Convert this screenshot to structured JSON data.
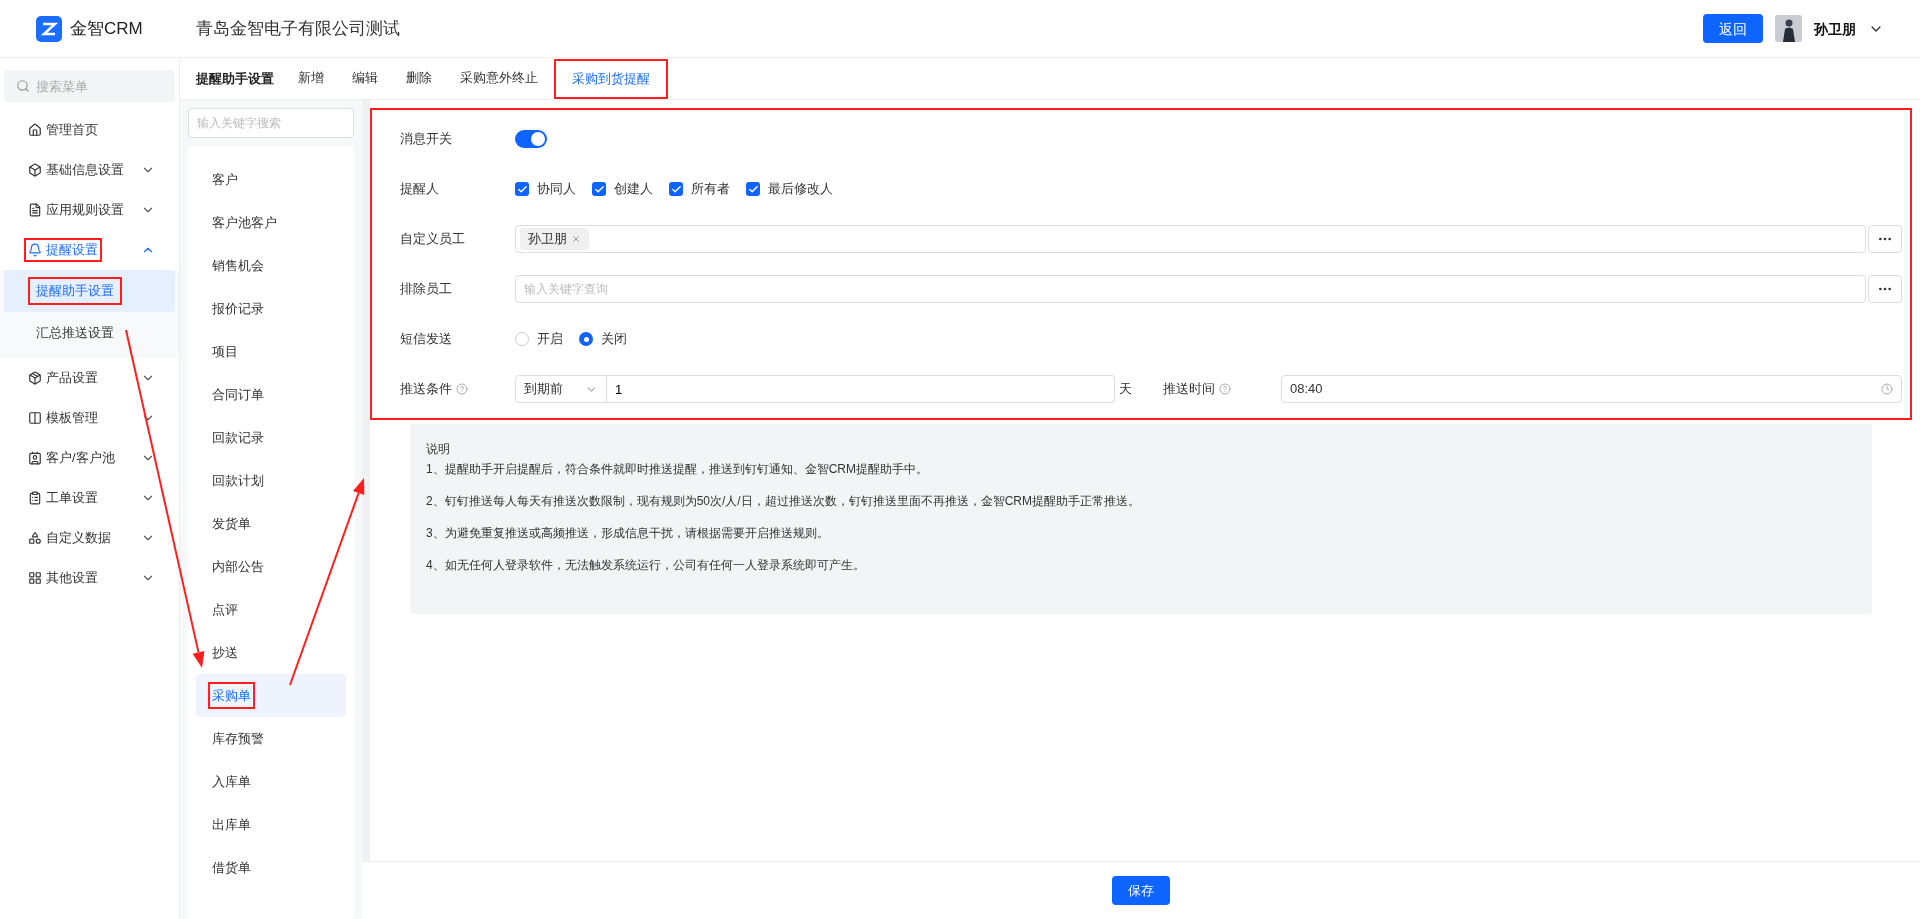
{
  "header": {
    "logo_text": "金智CRM",
    "company": "青岛金智电子有限公司测试",
    "back_button": "返回",
    "user_name": "孙卫朋"
  },
  "sidebar": {
    "search": {
      "placeholder": "搜索菜单"
    },
    "items": [
      {
        "label": "管理首页",
        "kind": "link",
        "marked": false
      },
      {
        "label": "基础信息设置",
        "kind": "group",
        "expanded": false,
        "marked": false
      },
      {
        "label": "应用规则设置",
        "kind": "group",
        "expanded": false,
        "marked": false
      },
      {
        "label": "提醒设置",
        "kind": "group",
        "expanded": true,
        "marked": true,
        "children": [
          {
            "label": "提醒助手设置",
            "selected": true,
            "marked": true
          },
          {
            "label": "汇总推送设置",
            "selected": false,
            "marked": false
          }
        ]
      },
      {
        "label": "产品设置",
        "kind": "group",
        "expanded": false,
        "marked": false
      },
      {
        "label": "模板管理",
        "kind": "group",
        "expanded": false,
        "marked": false
      },
      {
        "label": "客户/客户池",
        "kind": "group",
        "expanded": false,
        "marked": false
      },
      {
        "label": "工单设置",
        "kind": "group",
        "expanded": false,
        "marked": false
      },
      {
        "label": "自定义数据",
        "kind": "group",
        "expanded": false,
        "marked": false
      },
      {
        "label": "其他设置",
        "kind": "group",
        "expanded": false,
        "marked": false
      }
    ]
  },
  "toolbar": {
    "title": "提醒助手设置",
    "tabs": [
      {
        "label": "新增",
        "selected": false,
        "marked": false
      },
      {
        "label": "编辑",
        "selected": false,
        "marked": false
      },
      {
        "label": "删除",
        "selected": false,
        "marked": false
      },
      {
        "label": "采购意外终止",
        "selected": false,
        "marked": false
      },
      {
        "label": "采购到货提醒",
        "selected": true,
        "marked": true
      }
    ]
  },
  "module_list": {
    "search": {
      "placeholder": "输入关键字搜索"
    },
    "items": [
      {
        "label": "客户",
        "selected": false,
        "marked": false
      },
      {
        "label": "客户池客户",
        "selected": false,
        "marked": false
      },
      {
        "label": "销售机会",
        "selected": false,
        "marked": false
      },
      {
        "label": "报价记录",
        "selected": false,
        "marked": false
      },
      {
        "label": "项目",
        "selected": false,
        "marked": false
      },
      {
        "label": "合同订单",
        "selected": false,
        "marked": false
      },
      {
        "label": "回款记录",
        "selected": false,
        "marked": false
      },
      {
        "label": "回款计划",
        "selected": false,
        "marked": false
      },
      {
        "label": "发货单",
        "selected": false,
        "marked": false
      },
      {
        "label": "内部公告",
        "selected": false,
        "marked": false
      },
      {
        "label": "点评",
        "selected": false,
        "marked": false
      },
      {
        "label": "抄送",
        "selected": false,
        "marked": false
      },
      {
        "label": "采购单",
        "selected": true,
        "marked": true
      },
      {
        "label": "库存预警",
        "selected": false,
        "marked": false
      },
      {
        "label": "入库单",
        "selected": false,
        "marked": false
      },
      {
        "label": "出库单",
        "selected": false,
        "marked": false
      },
      {
        "label": "借货单",
        "selected": false,
        "marked": false
      }
    ]
  },
  "form": {
    "marked": true,
    "fields": [
      {
        "kind": "switch",
        "label": "消息开关",
        "on": true
      },
      {
        "kind": "checkboxes",
        "label": "提醒人",
        "options": [
          {
            "label": "协同人",
            "checked": true
          },
          {
            "label": "创建人",
            "checked": true
          },
          {
            "label": "所有者",
            "checked": true
          },
          {
            "label": "最后修改人",
            "checked": true
          }
        ]
      },
      {
        "kind": "tags",
        "label": "自定义员工",
        "tags": [
          "孙卫朋"
        ]
      },
      {
        "kind": "picker",
        "label": "排除员工",
        "placeholder": "输入关键字查询"
      },
      {
        "kind": "radios",
        "label": "短信发送",
        "options": [
          {
            "label": "开启",
            "selected": false
          },
          {
            "label": "关闭",
            "selected": true
          }
        ]
      },
      {
        "kind": "condition",
        "label": "推送条件",
        "select": "到期前",
        "value": "1",
        "unit": "天",
        "time_label": "推送时间",
        "time": "08:40"
      }
    ]
  },
  "notes": {
    "title": "说明",
    "lines": [
      "1、提醒助手开启提醒后，符合条件就即时推送提醒，推送到钉钉通知、金智CRM提醒助手中。",
      "2、钉钉推送每人每天有推送次数限制，现有规则为50次/人/日，超过推送次数，钉钉推送里面不再推送，金智CRM提醒助手正常推送。",
      "3、为避免重复推送或高频推送，形成信息干扰，请根据需要开启推送规则。",
      "4、如无任何人登录软件，无法触发系统运行，公司有任何一人登录系统即可产生。"
    ]
  },
  "save_button": "保存",
  "annotations": {
    "arrows": true
  }
}
